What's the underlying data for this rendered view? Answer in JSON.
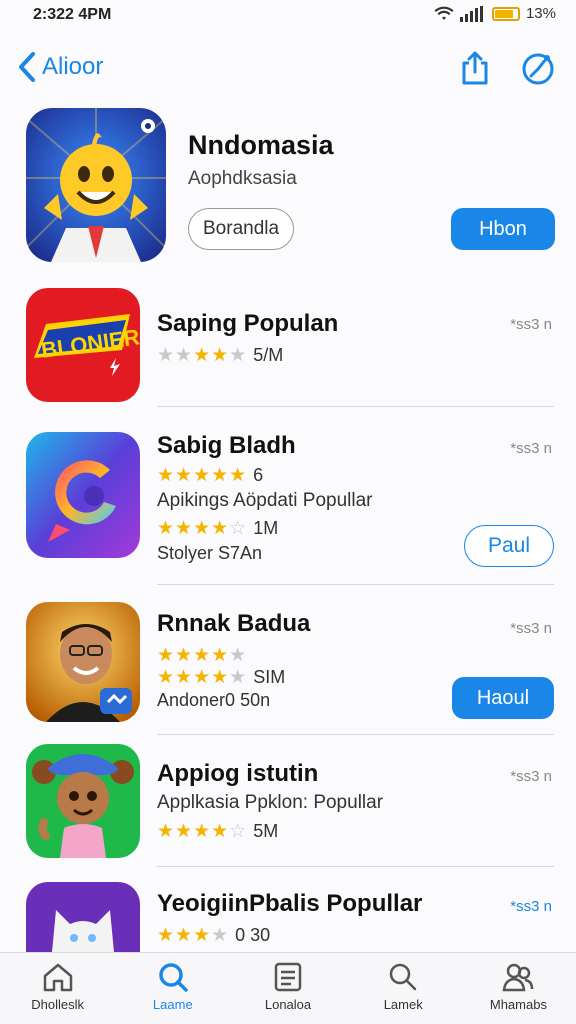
{
  "status": {
    "time": "2:322 4PM",
    "battery_text": "13%"
  },
  "nav": {
    "back_label": "Alioor"
  },
  "featured": {
    "title": "Nndomasia",
    "subtitle": "Aophdksasia",
    "secondary_label": "Borandla",
    "primary_label": "Hbon"
  },
  "apps": [
    {
      "title": "Saping Populan",
      "meta": "*ss3 n",
      "stars": 2.5,
      "rating_text": "5/M"
    },
    {
      "title": "Sabig Bladh",
      "meta": "*ss3 n",
      "stars": 5,
      "rating_text": "6",
      "subtitle": "Apikings Aöpdati Popullar",
      "stars2": 4,
      "rating_text2": "1M",
      "extra": "Stolyer S7An",
      "button_label": "Paul"
    },
    {
      "title": "Rnnak Badua",
      "meta": "*ss3 n",
      "stars": 4.5,
      "rating_text": "",
      "stars2": 4.5,
      "rating_text2": "SIM",
      "extra": "Andoner0 50n",
      "button_label": "Haoul"
    },
    {
      "title": "Appiog istutin",
      "meta": "*ss3 n",
      "subtitle": "Applkasia Ppklon: Popullar",
      "stars": 4,
      "rating_text": "5M"
    },
    {
      "title": "YeoigiinPbalis Popullar",
      "meta": "*ss3 n",
      "stars": 3.5,
      "rating_text": "0 30"
    }
  ],
  "tabs": [
    {
      "label": "Dholleslk",
      "icon": "home-icon"
    },
    {
      "label": "Laame",
      "icon": "search-icon"
    },
    {
      "label": "Lonaloa",
      "icon": "list-icon"
    },
    {
      "label": "Lamek",
      "icon": "magnifier-icon"
    },
    {
      "label": "Mhamabs",
      "icon": "people-icon"
    }
  ],
  "colors": {
    "accent": "#1a86e8",
    "star": "#f4b400"
  }
}
